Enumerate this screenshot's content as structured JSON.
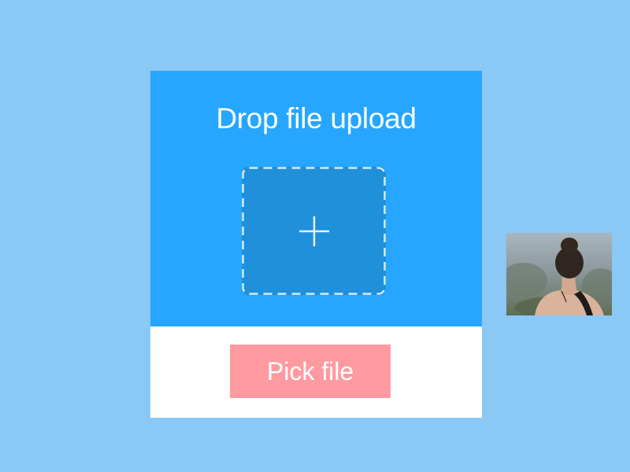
{
  "upload": {
    "title": "Drop file upload",
    "dropzone_icon": "plus-icon",
    "pick_button_label": "Pick file"
  },
  "thumbnail": {
    "subject": "photo of a woman seen from behind, hair in a bun"
  },
  "colors": {
    "background": "#8ac8f5",
    "panel": "#26a6ff",
    "dropzone": "#1f90d9",
    "button": "#ff9aa0",
    "card": "#ffffff"
  }
}
